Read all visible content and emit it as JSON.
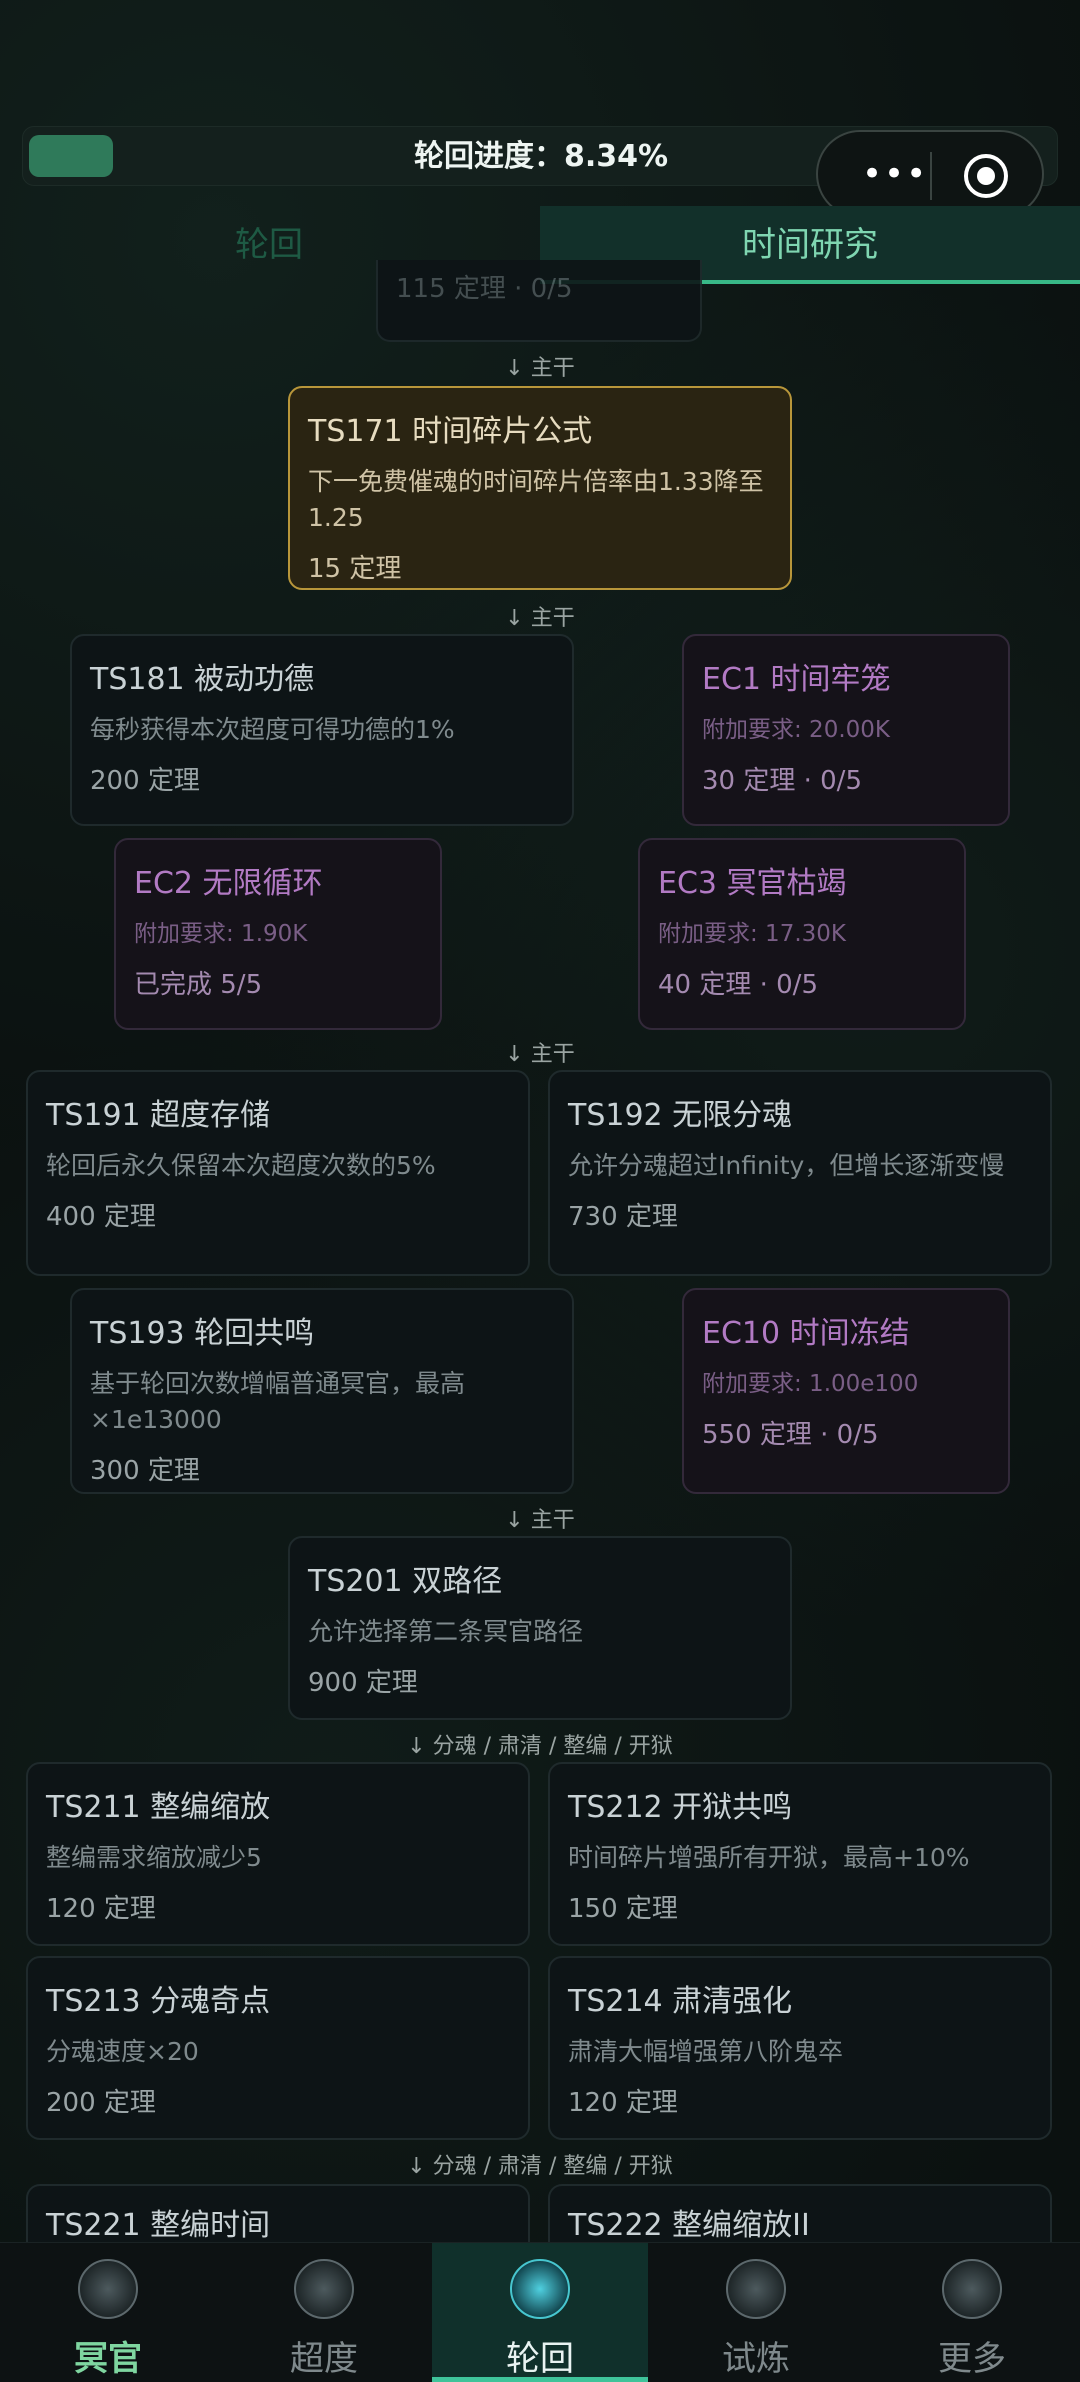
{
  "progress": {
    "label": "轮回进度：8.34%",
    "value": 0.0834
  },
  "tabs": {
    "left": "轮回",
    "right": "时间研究"
  },
  "partial_top_text": "115 定理 · 0/5",
  "connectors": {
    "c1": "↓ 主干",
    "c2": "↓ 主干",
    "c3": "↓ 主干",
    "c4": "↓ 主干",
    "c5": "↓ 分魂 / 肃清 / 整编 / 开狱",
    "c6": "↓ 分魂 / 肃清 / 整编 / 开狱"
  },
  "cards": {
    "ts171": {
      "title": "TS171 时间碎片公式",
      "desc": "下一免费催魂的时间碎片倍率由1.33降至1.25",
      "cost": "15 定理"
    },
    "ts181": {
      "title": "TS181 被动功德",
      "desc": "每秒获得本次超度可得功德的1%",
      "cost": "200 定理"
    },
    "ec1": {
      "title": "EC1 时间牢笼",
      "desc": "附加要求: 20.00K",
      "cost": "30 定理 · 0/5"
    },
    "ec2": {
      "title": "EC2 无限循环",
      "desc": "附加要求: 1.90K",
      "cost": "已完成 5/5"
    },
    "ec3": {
      "title": "EC3 冥官枯竭",
      "desc": "附加要求: 17.30K",
      "cost": "40 定理 · 0/5"
    },
    "ts191": {
      "title": "TS191 超度存储",
      "desc": "轮回后永久保留本次超度次数的5%",
      "cost": "400 定理"
    },
    "ts192": {
      "title": "TS192 无限分魂",
      "desc": "允许分魂超过Infinity，但增长逐渐变慢",
      "cost": "730 定理"
    },
    "ts193": {
      "title": "TS193 轮回共鸣",
      "desc": "基于轮回次数增幅普通冥官，最高×1e13000",
      "cost": "300 定理"
    },
    "ec10": {
      "title": "EC10 时间冻结",
      "desc": "附加要求: 1.00e100",
      "cost": "550 定理 · 0/5"
    },
    "ts201": {
      "title": "TS201 双路径",
      "desc": "允许选择第二条冥官路径",
      "cost": "900 定理"
    },
    "ts211": {
      "title": "TS211 整编缩放",
      "desc": "整编需求缩放减少5",
      "cost": "120 定理"
    },
    "ts212": {
      "title": "TS212 开狱共鸣",
      "desc": "时间碎片增强所有开狱，最高+10%",
      "cost": "150 定理"
    },
    "ts213": {
      "title": "TS213 分魂奇点",
      "desc": "分魂速度×20",
      "cost": "200 定理"
    },
    "ts214": {
      "title": "TS214 肃清强化",
      "desc": "肃清大幅增强第八阶鬼卒",
      "cost": "120 定理"
    },
    "ts221": {
      "title": "TS221 整编时间"
    },
    "ts222": {
      "title": "TS222 整编缩放II"
    }
  },
  "bottom_nav": [
    {
      "label": "冥官",
      "icon": "ghost-official-icon"
    },
    {
      "label": "超度",
      "icon": "temple-icon"
    },
    {
      "label": "轮回",
      "icon": "rebirth-icon"
    },
    {
      "label": "试炼",
      "icon": "trial-icon"
    },
    {
      "label": "更多",
      "icon": "more-icon"
    }
  ]
}
